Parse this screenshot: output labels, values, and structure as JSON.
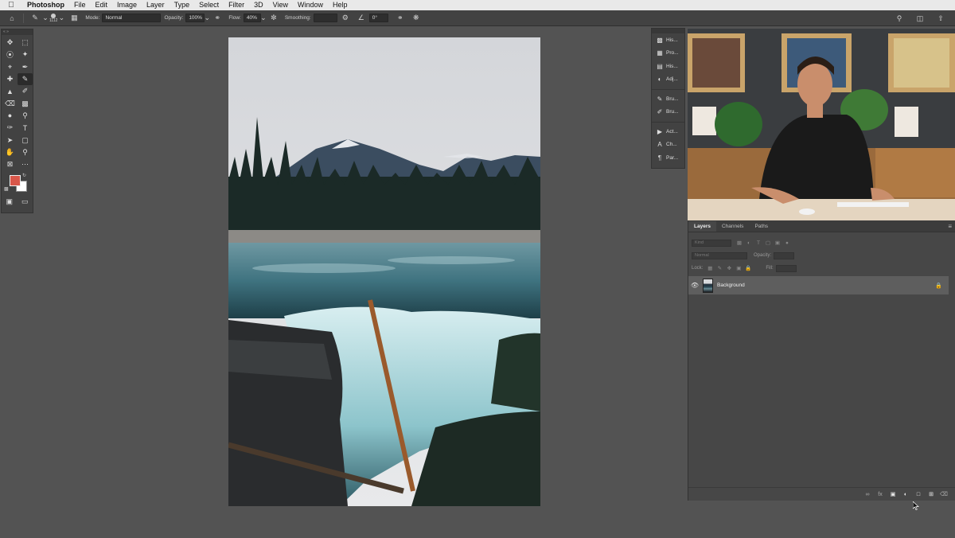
{
  "menubar": {
    "apple": "",
    "app_name": "Photoshop",
    "items": [
      "File",
      "Edit",
      "Image",
      "Layer",
      "Type",
      "Select",
      "Filter",
      "3D",
      "View",
      "Window",
      "Help"
    ]
  },
  "options_bar": {
    "brush_size": "1112",
    "mode_label": "Mode:",
    "mode_value": "Normal",
    "opacity_label": "Opacity:",
    "opacity_value": "100%",
    "flow_label": "Flow:",
    "flow_value": "40%",
    "smoothing_label": "Smoothing:",
    "smoothing_value": "",
    "angle_value": "0°"
  },
  "dock": {
    "items": [
      {
        "label": "His...",
        "icon": "histogram-icon"
      },
      {
        "label": "Pro...",
        "icon": "properties-icon"
      },
      {
        "label": "His...",
        "icon": "history-icon"
      },
      {
        "label": "Adj...",
        "icon": "adjustments-icon"
      },
      {
        "label": "Bru...",
        "icon": "brush-icon"
      },
      {
        "label": "Bru...",
        "icon": "brush-settings-icon"
      },
      {
        "label": "Act...",
        "icon": "actions-icon"
      },
      {
        "label": "Ch...",
        "icon": "character-icon"
      },
      {
        "label": "Par...",
        "icon": "paragraph-icon"
      }
    ]
  },
  "layers_panel": {
    "tabs": [
      "Layers",
      "Channels",
      "Paths"
    ],
    "active_tab": "Layers",
    "kind_placeholder": "Kind",
    "blend_mode": "Normal",
    "opacity_label": "Opacity:",
    "lock_label": "Lock:",
    "fill_label": "Fill:",
    "layers": [
      {
        "name": "Background",
        "visible": true,
        "locked": true
      }
    ]
  },
  "colors": {
    "foreground": "#d9574a",
    "background": "#ffffff",
    "workspace": "#535353",
    "panel": "#424242"
  }
}
